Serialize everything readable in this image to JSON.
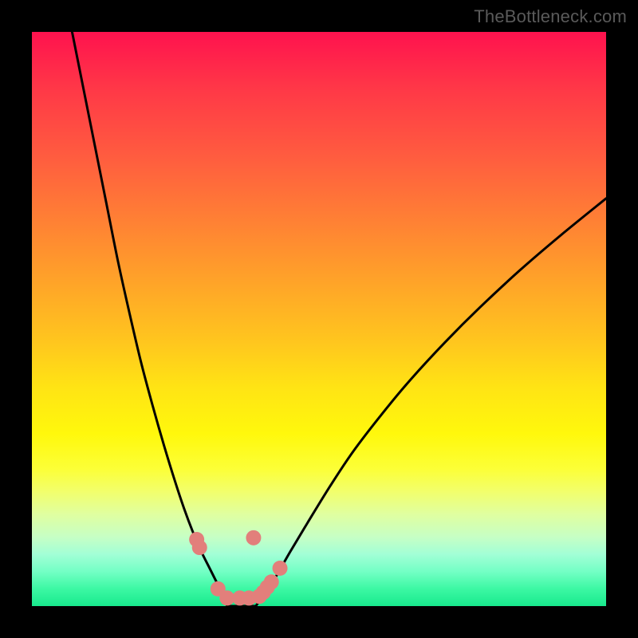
{
  "watermark": "TheBottleneck.com",
  "chart_data": {
    "type": "line",
    "title": "",
    "xlabel": "",
    "ylabel": "",
    "xlim": [
      0,
      100
    ],
    "ylim": [
      0,
      100
    ],
    "background_gradient_stops": [
      {
        "pct": 0,
        "color": "#ff124e"
      },
      {
        "pct": 50,
        "color": "#ffd21a"
      },
      {
        "pct": 80,
        "color": "#f7ff4a"
      },
      {
        "pct": 100,
        "color": "#18e98d"
      }
    ],
    "series": [
      {
        "name": "left-curve",
        "color": "#000000",
        "x": [
          7,
          9,
          11,
          13,
          15,
          17,
          19,
          21,
          23,
          25,
          26.5,
          28,
          29.5,
          31,
          32,
          33,
          34
        ],
        "y": [
          100,
          90,
          80,
          70,
          60,
          51,
          42.5,
          35,
          28,
          21.5,
          17,
          13,
          9.5,
          6.5,
          4.5,
          2.5,
          0
        ]
      },
      {
        "name": "right-curve",
        "color": "#000000",
        "x": [
          39,
          40,
          41.5,
          43,
          45,
          48,
          52,
          56,
          61,
          66,
          72,
          78,
          85,
          92,
          100
        ],
        "y": [
          0,
          1.5,
          3.5,
          6,
          9.5,
          14.5,
          21,
          27,
          33.5,
          39.5,
          46,
          52,
          58.5,
          64.5,
          71
        ]
      },
      {
        "name": "seam-flat",
        "color": "#000000",
        "x": [
          34,
          36,
          39
        ],
        "y": [
          0,
          0,
          0
        ]
      }
    ],
    "markers": {
      "name": "low-region-markers",
      "color": "#e27f7b",
      "points": [
        {
          "x": 28.7,
          "y": 11.6
        },
        {
          "x": 29.2,
          "y": 10.2
        },
        {
          "x": 32.4,
          "y": 3.0
        },
        {
          "x": 34.0,
          "y": 1.4
        },
        {
          "x": 36.2,
          "y": 1.4
        },
        {
          "x": 37.8,
          "y": 1.4
        },
        {
          "x": 39.6,
          "y": 1.7
        },
        {
          "x": 40.3,
          "y": 2.4
        },
        {
          "x": 41.0,
          "y": 3.3
        },
        {
          "x": 41.7,
          "y": 4.2
        },
        {
          "x": 43.2,
          "y": 6.6
        },
        {
          "x": 38.6,
          "y": 11.9
        }
      ]
    }
  }
}
